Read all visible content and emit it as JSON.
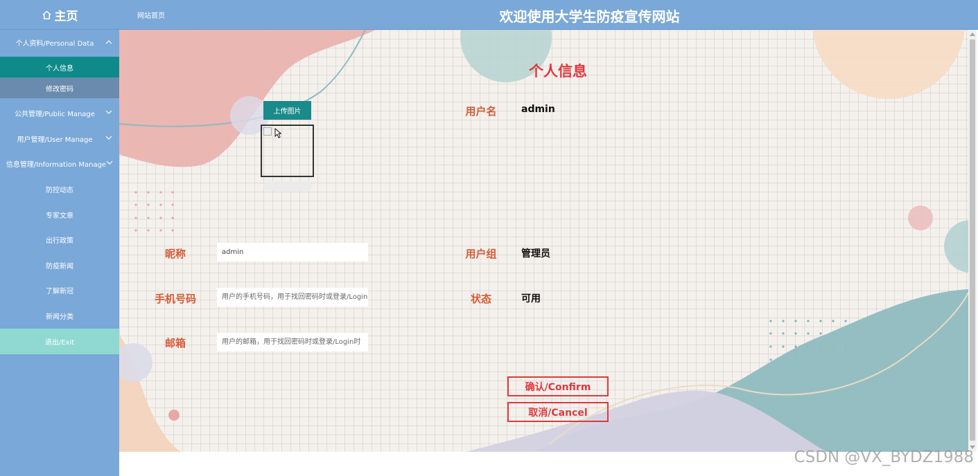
{
  "header": {
    "home_label": "主页",
    "site_link": "网站首页",
    "site_title": "欢迎使用大学生防疫宣传网站"
  },
  "sidebar": {
    "groups": [
      {
        "label": "个人资料/Personal Data",
        "expanded": true
      },
      {
        "label": "公共管理/Public Manage",
        "expanded": false
      },
      {
        "label": "用户管理/User Manage",
        "expanded": false
      },
      {
        "label": "信息管理/Information Manage",
        "expanded": false
      }
    ],
    "personal_sub": [
      "个人信息",
      "修改密码"
    ],
    "info_items": [
      "防控动态",
      "专家文章",
      "出行政策",
      "防疫新闻",
      "了解新冠",
      "新闻分类"
    ],
    "exit": "退出/Exit"
  },
  "form": {
    "title": "个人信息",
    "upload_button": "上传图片",
    "fields": {
      "username": {
        "label": "用户名",
        "value": "admin"
      },
      "nickname": {
        "label": "昵称",
        "value": "admin"
      },
      "user_group": {
        "label": "用户组",
        "value": "管理员"
      },
      "phone": {
        "label": "手机号码",
        "value": "",
        "placeholder": "用户的手机号码，用于找回密码时或登录/Login时"
      },
      "status": {
        "label": "状态",
        "value": "可用"
      },
      "email": {
        "label": "邮箱",
        "value": "",
        "placeholder": "用户的邮箱，用于找回密码时或登录/Login时"
      }
    },
    "confirm": "确认/Confirm",
    "cancel": "取消/Cancel"
  },
  "watermark": "CSDN @VX_BYDZ1988",
  "colors": {
    "header": "#7aa8d8",
    "sidebar_active": "#0e8a8a",
    "sidebar_sub": "#6a8bad",
    "sidebar_exit": "#8fd9d2",
    "accent_red": "#e0383e",
    "label_orange": "#d55b37",
    "upload_button": "#1a8a8a"
  }
}
